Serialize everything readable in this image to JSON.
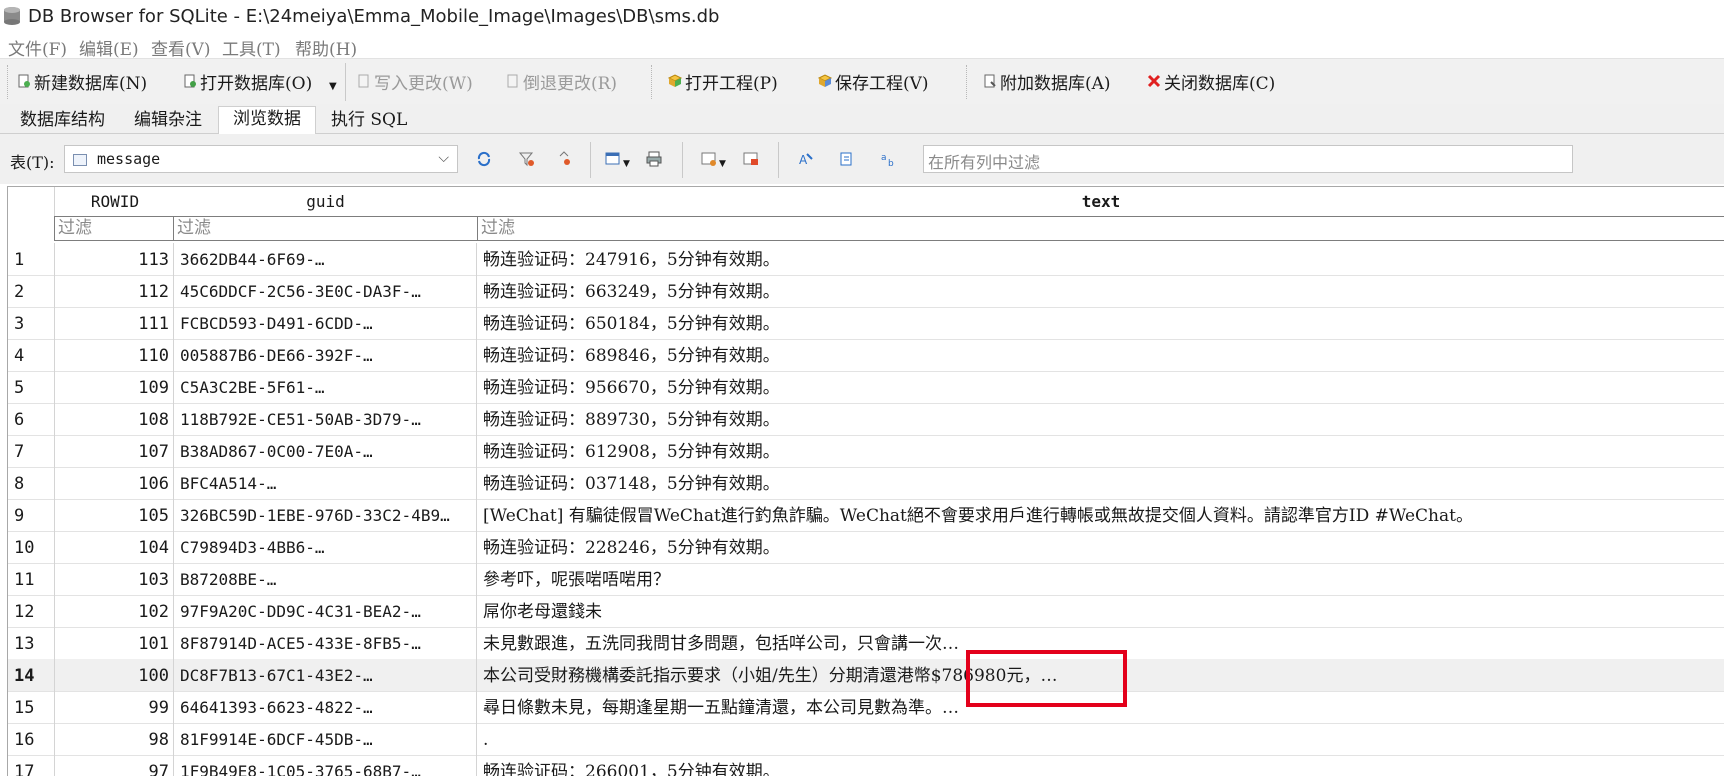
{
  "window": {
    "title": "DB Browser for SQLite - E:\\24meiya\\Emma_Mobile_Image\\Images\\DB\\sms.db"
  },
  "menu": [
    "文件(F)",
    "编辑(E)",
    "查看(V)",
    "工具(T)",
    "帮助(H)"
  ],
  "toolbar": {
    "new_db": "新建数据库(N)",
    "open_db": "打开数据库(O)",
    "write_changes": "写入更改(W)",
    "revert_changes": "倒退更改(R)",
    "open_project": "打开工程(P)",
    "save_project": "保存工程(V)",
    "attach_db": "附加数据库(A)",
    "close_db": "关闭数据库(C)"
  },
  "tabs": [
    "数据库结构",
    "编辑杂注",
    "浏览数据",
    "执行 SQL"
  ],
  "active_tab": "浏览数据",
  "browse": {
    "table_label": "表(T):",
    "table_value": "message",
    "filter_all_placeholder": "在所有列中过滤"
  },
  "grid": {
    "columns": [
      "ROWID",
      "guid",
      "text"
    ],
    "filter_placeholder": "过滤",
    "selected_row": 14,
    "rows": [
      {
        "n": "1",
        "rowid": "113",
        "guid": "3662DB44-6F69-…",
        "text": "畅连验证码：247916，5分钟有效期。"
      },
      {
        "n": "2",
        "rowid": "112",
        "guid": "45C6DDCF-2C56-3E0C-DA3F-…",
        "text": "畅连验证码：663249，5分钟有效期。"
      },
      {
        "n": "3",
        "rowid": "111",
        "guid": "FCBCD593-D491-6CDD-…",
        "text": "畅连验证码：650184，5分钟有效期。"
      },
      {
        "n": "4",
        "rowid": "110",
        "guid": "005887B6-DE66-392F-…",
        "text": "畅连验证码：689846，5分钟有效期。"
      },
      {
        "n": "5",
        "rowid": "109",
        "guid": "C5A3C2BE-5F61-…",
        "text": "畅连验证码：956670，5分钟有效期。"
      },
      {
        "n": "6",
        "rowid": "108",
        "guid": "118B792E-CE51-50AB-3D79-…",
        "text": "畅连验证码：889730，5分钟有效期。"
      },
      {
        "n": "7",
        "rowid": "107",
        "guid": "B38AD867-0C00-7E0A-…",
        "text": "畅连验证码：612908，5分钟有效期。"
      },
      {
        "n": "8",
        "rowid": "106",
        "guid": "BFC4A514-…",
        "text": "畅连验证码：037148，5分钟有效期。"
      },
      {
        "n": "9",
        "rowid": "105",
        "guid": "326BC59D-1EBE-976D-33C2-4B9…",
        "text": "[WeChat] 有騙徒假冒WeChat進行釣魚詐騙。WeChat絕不會要求用戶進行轉帳或無故提交個人資料。請認準官方ID #WeChat。"
      },
      {
        "n": "10",
        "rowid": "104",
        "guid": "C79894D3-4BB6-…",
        "text": "畅连验证码：228246，5分钟有效期。"
      },
      {
        "n": "11",
        "rowid": "103",
        "guid": "B87208BE-…",
        "text": "參考吓，呢張啱唔啱用？"
      },
      {
        "n": "12",
        "rowid": "102",
        "guid": "97F9A20C-DD9C-4C31-BEA2-…",
        "text": "屌你老母還錢未"
      },
      {
        "n": "13",
        "rowid": "101",
        "guid": "8F87914D-ACE5-433E-8FB5-…",
        "text": "未見數跟進，五洗同我問甘多問題，包括咩公司，只會講一次…"
      },
      {
        "n": "14",
        "rowid": "100",
        "guid": "DC8F7B13-67C1-43E2-…",
        "text": "本公司受財務機構委託指示要求（小姐/先生）分期清還港幣$786980元，…"
      },
      {
        "n": "15",
        "rowid": "99",
        "guid": "64641393-6623-4822-…",
        "text": "尋日條數未見，每期逢星期一五點鐘清還，本公司見數為準。…"
      },
      {
        "n": "16",
        "rowid": "98",
        "guid": "81F9914E-6DCF-45DB-…",
        "text": "."
      },
      {
        "n": "17",
        "rowid": "97",
        "guid": "1F9B49E8-1C05-3765-68B7-…",
        "text": "畅连验证码：266001，5分钟有效期。"
      }
    ]
  },
  "colors": {
    "toolbar_bg": "#f1f1f1",
    "highlight_box": "#e3001b",
    "selected_row_bg": "#f0f0f0"
  }
}
